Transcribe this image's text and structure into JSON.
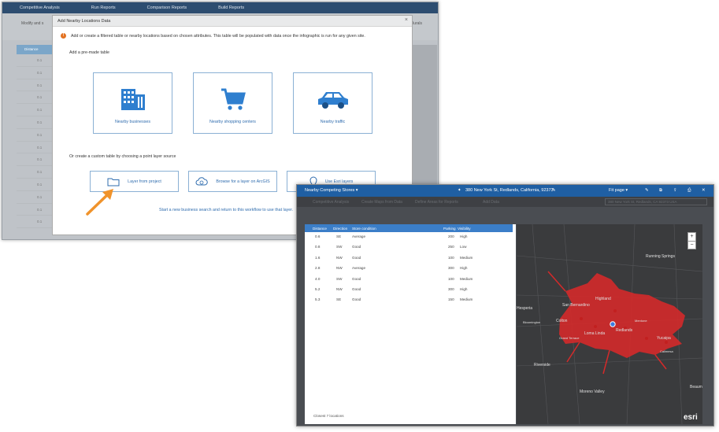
{
  "back_window": {
    "nav_tabs": [
      "Competitive Analysis",
      "Run Reports",
      "Comparison Reports",
      "Build Reports"
    ],
    "sub_left": "Modify and s",
    "sub_right": "slurals",
    "grid_header": "Distance",
    "grid_values": [
      "0.1",
      "0.1",
      "0.1",
      "0.1",
      "0.1",
      "0.1",
      "0.1",
      "0.1",
      "0.1",
      "0.1",
      "0.1",
      "0.1",
      "0.1",
      "0.1",
      "0.1"
    ]
  },
  "dialog": {
    "title": "Add Nearby Locations Data",
    "close": "×",
    "info_icon": "!",
    "info_text": "Add or create a filtered table or nearby locations based on chosen attributes. This table will be populated with data once the infographic is run for any given site.",
    "premade_label": "Add a pre-made table",
    "cards": [
      {
        "label": "Nearby businesses",
        "icon": "building-icon"
      },
      {
        "label": "Nearby shopping centers",
        "icon": "shopping-cart-icon"
      },
      {
        "label": "Nearby traffic",
        "icon": "car-icon"
      }
    ],
    "custom_label": "Or create a custom table by choosing a point layer source",
    "buttons": [
      {
        "label": "Layer from project",
        "icon": "folder-icon"
      },
      {
        "label": "Browse for a layer on ArcGIS",
        "icon": "cloud-browse-icon"
      },
      {
        "label": "Use Esri layers",
        "icon": "map-pin-icon"
      }
    ],
    "bottom_link": "Start a new business search and return to this workflow to use that layer."
  },
  "front_window": {
    "dropdown": "Nearby Competing Stores ▾",
    "address": "380 New York St, Redlands, California, 92373",
    "fit": "Fit page ▾",
    "tabs": [
      "Competitive Analysis",
      "Create Maps from Data",
      "Define Areas for Reports",
      "Add Data"
    ],
    "address_box": "380 New York St, Redlands, CA 92373 USA",
    "table": {
      "headers": [
        "Distance",
        "Direction",
        "Store condition",
        "Parking",
        "Visibility"
      ],
      "rows": [
        [
          "0.6",
          "SE",
          "Average",
          "200",
          "High"
        ],
        [
          "0.8",
          "SW",
          "Good",
          "250",
          "Low"
        ],
        [
          "1.6",
          "NW",
          "Good",
          "100",
          "Medium"
        ],
        [
          "2.8",
          "NW",
          "Average",
          "300",
          "High"
        ],
        [
          "4.0",
          "SW",
          "Good",
          "100",
          "Medium"
        ],
        [
          "5.2",
          "NW",
          "Good",
          "300",
          "High"
        ],
        [
          "5.3",
          "SE",
          "Good",
          "150",
          "Medium"
        ]
      ],
      "footer": "Closest 7 locations"
    },
    "map": {
      "labels": [
        "Running Springs",
        "Highland",
        "San Bernardino",
        "Redlands",
        "Loma Linda",
        "Colton",
        "Yucaipa",
        "Calimesa",
        "Riverside",
        "Moreno Valley",
        "Beaum",
        "Grand Terrace",
        "Bloomington",
        "Mentone",
        "Hesperia"
      ],
      "zoom_in": "+",
      "zoom_out": "−",
      "logo": "esri",
      "colors": {
        "drive_area": "#d42a2a",
        "marker": "#3d7be0",
        "base": "#3a3b3d"
      }
    }
  }
}
